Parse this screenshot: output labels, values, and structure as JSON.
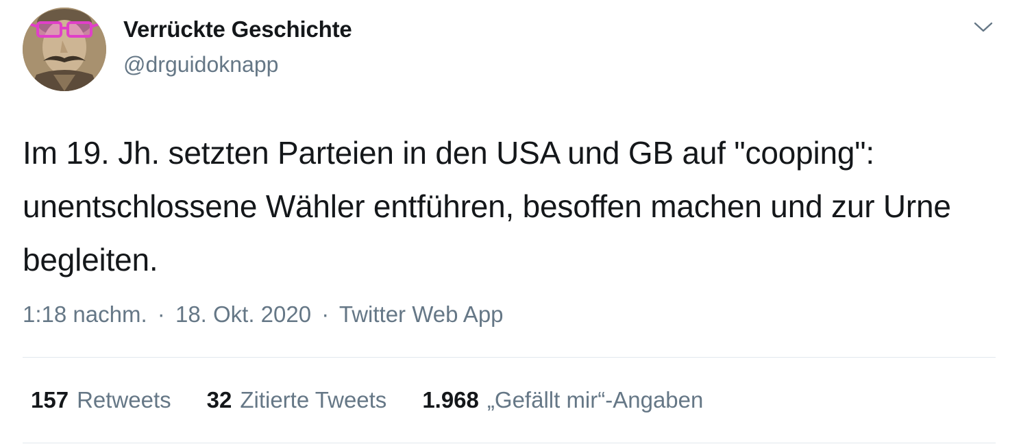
{
  "author": {
    "display_name": "Verrückte Geschichte",
    "handle": "@drguidoknapp",
    "avatar_icon": "avatar-portrait-mustache-pink-glasses"
  },
  "menu": {
    "caret_icon": "chevron-down-icon"
  },
  "tweet": {
    "text": "Im 19. Jh. setzten Parteien in den USA und GB auf \"cooping\": unentschlossene Wähler entführen, besoffen machen und zur Urne begleiten."
  },
  "meta": {
    "time": "1:18 nachm.",
    "separator": "·",
    "date": "18. Okt. 2020",
    "source": "Twitter Web App"
  },
  "stats": {
    "retweets_count": "157",
    "retweets_label": "Retweets",
    "quotes_count": "32",
    "quotes_label": "Zitierte Tweets",
    "likes_count": "1.968",
    "likes_label": "„Gefällt mir“-Angaben"
  },
  "colors": {
    "text_primary": "#14171a",
    "text_secondary": "#657786",
    "divider": "#e1e8ed",
    "glasses_accent": "#e040c8"
  }
}
